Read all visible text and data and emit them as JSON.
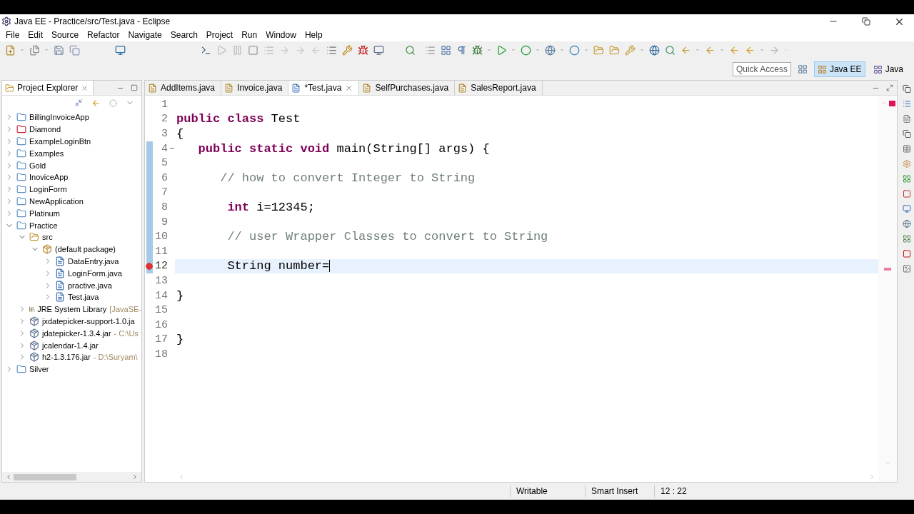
{
  "window": {
    "title": "Java EE - Practice/src/Test.java - Eclipse"
  },
  "menu": [
    "File",
    "Edit",
    "Source",
    "Refactor",
    "Navigate",
    "Search",
    "Project",
    "Run",
    "Window",
    "Help"
  ],
  "quick_access": {
    "placeholder": "Quick Access"
  },
  "perspectives": [
    {
      "label": "Java EE",
      "selected": true
    },
    {
      "label": "Java",
      "selected": false
    }
  ],
  "project_explorer": {
    "title": "Project Explorer",
    "tree": [
      {
        "label": "BillingInvoiceApp",
        "kind": "project",
        "expanded": false
      },
      {
        "label": "Diamond",
        "kind": "project-error",
        "expanded": false
      },
      {
        "label": "ExampleLoginBtn",
        "kind": "project",
        "expanded": false
      },
      {
        "label": "Examples",
        "kind": "project",
        "expanded": false
      },
      {
        "label": "Gold",
        "kind": "project",
        "expanded": false
      },
      {
        "label": "InoviceApp",
        "kind": "project",
        "expanded": false
      },
      {
        "label": "LoginForm",
        "kind": "project",
        "expanded": false
      },
      {
        "label": "NewApplication",
        "kind": "project",
        "expanded": false
      },
      {
        "label": "Platinum",
        "kind": "project",
        "expanded": false
      },
      {
        "label": "Practice",
        "kind": "project",
        "expanded": true,
        "children": [
          {
            "label": "src",
            "kind": "folder",
            "expanded": true,
            "children": [
              {
                "label": "(default package)",
                "kind": "package",
                "expanded": true,
                "children": [
                  {
                    "label": "DataEntry.java",
                    "kind": "java",
                    "expanded": false
                  },
                  {
                    "label": "LoginForm.java",
                    "kind": "java",
                    "expanded": false
                  },
                  {
                    "label": "practive.java",
                    "kind": "java",
                    "expanded": false
                  },
                  {
                    "label": "Test.java",
                    "kind": "java",
                    "expanded": false
                  }
                ]
              }
            ]
          },
          {
            "label": "JRE System Library",
            "suffix": "[JavaSE-",
            "kind": "library",
            "expanded": false
          },
          {
            "label": "jxdatepicker-support-1.0.ja",
            "kind": "jar",
            "expanded": false
          },
          {
            "label": "jdatepicker-1.3.4.jar",
            "suffix": "- C:\\Us",
            "kind": "jar",
            "expanded": false
          },
          {
            "label": "jcalendar-1.4.jar",
            "kind": "jar",
            "expanded": false
          },
          {
            "label": "h2-1.3.176.jar",
            "suffix": "- D:\\Suryam\\",
            "kind": "jar",
            "expanded": false
          }
        ]
      },
      {
        "label": "Silver",
        "kind": "project",
        "expanded": false
      }
    ]
  },
  "editor_tabs": [
    {
      "label": "AddItems.java",
      "selected": false
    },
    {
      "label": "Invoice.java",
      "selected": false
    },
    {
      "label": "*Test.java",
      "selected": true
    },
    {
      "label": "SelfPurchases.java",
      "selected": false
    },
    {
      "label": "SalesReport.java",
      "selected": false
    }
  ],
  "code_lines": [
    {
      "number": "1",
      "changed": false,
      "error": false,
      "current": false
    },
    {
      "number": "2",
      "changed": false,
      "error": false,
      "current": false,
      "tokens": [
        {
          "kind": "keyword",
          "text": "public class"
        },
        {
          "kind": "plain",
          "text": " Test"
        }
      ]
    },
    {
      "number": "3",
      "changed": false,
      "error": false,
      "current": false,
      "tokens": [
        {
          "kind": "plain",
          "text": "{"
        }
      ]
    },
    {
      "number": "4",
      "changed": true,
      "error": false,
      "current": false,
      "fold": true,
      "tokens": [
        {
          "kind": "keyword",
          "text": "   public static void"
        },
        {
          "kind": "plain",
          "text": " main(String[] args) {"
        }
      ]
    },
    {
      "number": "5",
      "changed": true,
      "error": false,
      "current": false
    },
    {
      "number": "6",
      "changed": true,
      "error": false,
      "current": false,
      "tokens": [
        {
          "kind": "comment",
          "text": "      // how to convert Integer to String"
        }
      ]
    },
    {
      "number": "7",
      "changed": true,
      "error": false,
      "current": false
    },
    {
      "number": "8",
      "changed": true,
      "error": false,
      "current": false,
      "tokens": [
        {
          "kind": "keyword",
          "text": "       int"
        },
        {
          "kind": "plain",
          "text": " i=12345;"
        }
      ]
    },
    {
      "number": "9",
      "changed": true,
      "error": false,
      "current": false
    },
    {
      "number": "10",
      "changed": true,
      "error": false,
      "current": false,
      "tokens": [
        {
          "kind": "comment",
          "text": "       // user Wrapper Classes to convert to String"
        }
      ]
    },
    {
      "number": "11",
      "changed": true,
      "error": false,
      "current": false
    },
    {
      "number": "12",
      "changed": true,
      "error": true,
      "current": true,
      "tokens": [
        {
          "kind": "plain",
          "text": "       String number="
        }
      ]
    },
    {
      "number": "13",
      "changed": false,
      "error": false,
      "current": false
    },
    {
      "number": "14",
      "changed": false,
      "error": false,
      "current": false,
      "tokens": [
        {
          "kind": "plain",
          "text": "}"
        }
      ]
    },
    {
      "number": "15",
      "changed": false,
      "error": false,
      "current": false
    },
    {
      "number": "16",
      "changed": false,
      "error": false,
      "current": false
    },
    {
      "number": "17",
      "changed": false,
      "error": false,
      "current": false,
      "tokens": [
        {
          "kind": "plain",
          "text": "}"
        }
      ]
    },
    {
      "number": "18",
      "changed": false,
      "error": false,
      "current": false
    }
  ],
  "status_bar": [
    "Writable",
    "Smart Insert",
    "12 : 22"
  ]
}
